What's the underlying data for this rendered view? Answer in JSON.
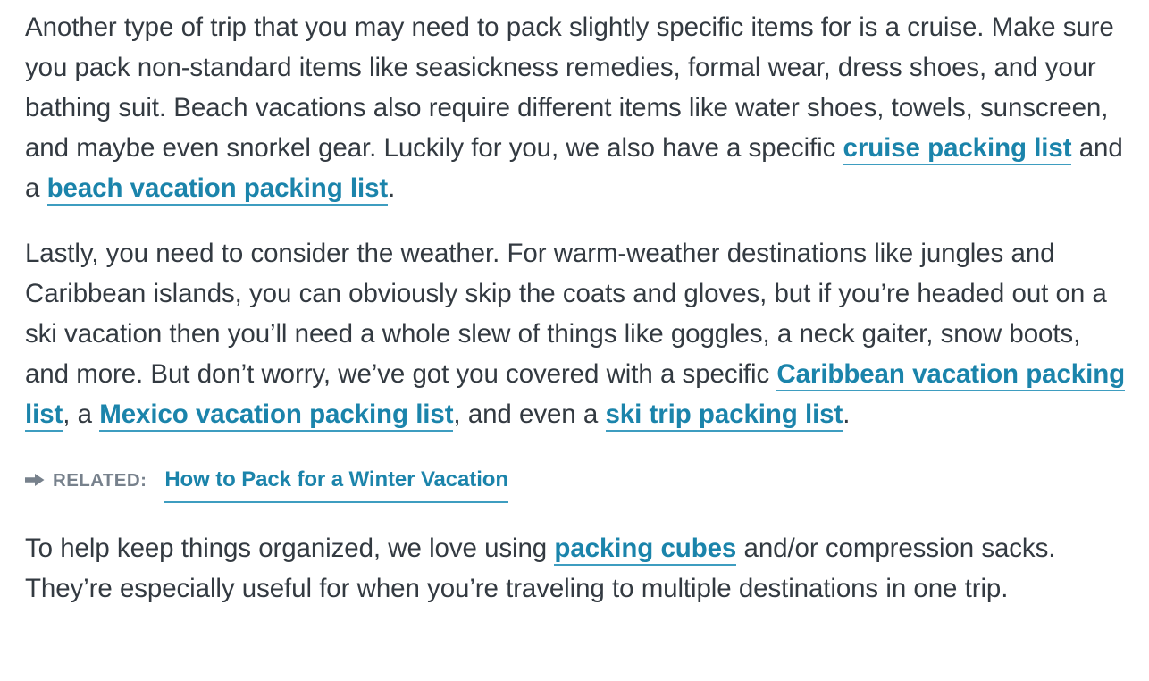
{
  "article": {
    "paragraphs": [
      {
        "id": "cruise-beach",
        "segments": [
          {
            "type": "text",
            "value": "Another type of trip that you may need to pack slightly specific items for is a cruise. Make sure you pack non-standard items like seasickness remedies, formal wear, dress shoes, and your bathing suit. Beach vacations also require different items like water shoes, towels, sunscreen, and maybe even snorkel gear. Luckily for you, we also have a specific "
          },
          {
            "type": "link",
            "value": "cruise packing list"
          },
          {
            "type": "text",
            "value": " and a "
          },
          {
            "type": "link",
            "value": "beach vacation packing list"
          },
          {
            "type": "text",
            "value": "."
          }
        ]
      },
      {
        "id": "weather",
        "segments": [
          {
            "type": "text",
            "value": "Lastly, you need to consider the weather. For warm-weather destinations like jungles and Caribbean islands, you can obviously skip the coats and gloves, but if you’re headed out on a ski vacation then you’ll need a whole slew of things like goggles, a neck gaiter, snow boots, and more. But don’t worry, we’ve got you covered with a specific "
          },
          {
            "type": "link",
            "value": "Caribbean vacation packing list"
          },
          {
            "type": "text",
            "value": ", a "
          },
          {
            "type": "link",
            "value": "Mexico vacation packing list"
          },
          {
            "type": "text",
            "value": ", and even a "
          },
          {
            "type": "link",
            "value": "ski trip packing list"
          },
          {
            "type": "text",
            "value": "."
          }
        ]
      },
      {
        "id": "packing-cubes",
        "segments": [
          {
            "type": "text",
            "value": "To help keep things organized, we love using "
          },
          {
            "type": "link",
            "value": "packing cubes"
          },
          {
            "type": "text",
            "value": " and/or compression sacks. They’re especially useful for when you’re traveling to multiple destinations in one trip."
          }
        ]
      }
    ],
    "related": {
      "arrow_icon": "arrow-right-icon",
      "label": "RELATED:",
      "link_text": "How to Pack for a Winter Vacation"
    }
  },
  "colors": {
    "body_text": "#333a41",
    "link": "#1b84ab",
    "link_underline": "#3e9dc0",
    "related_label": "#77818c",
    "background": "#ffffff"
  }
}
